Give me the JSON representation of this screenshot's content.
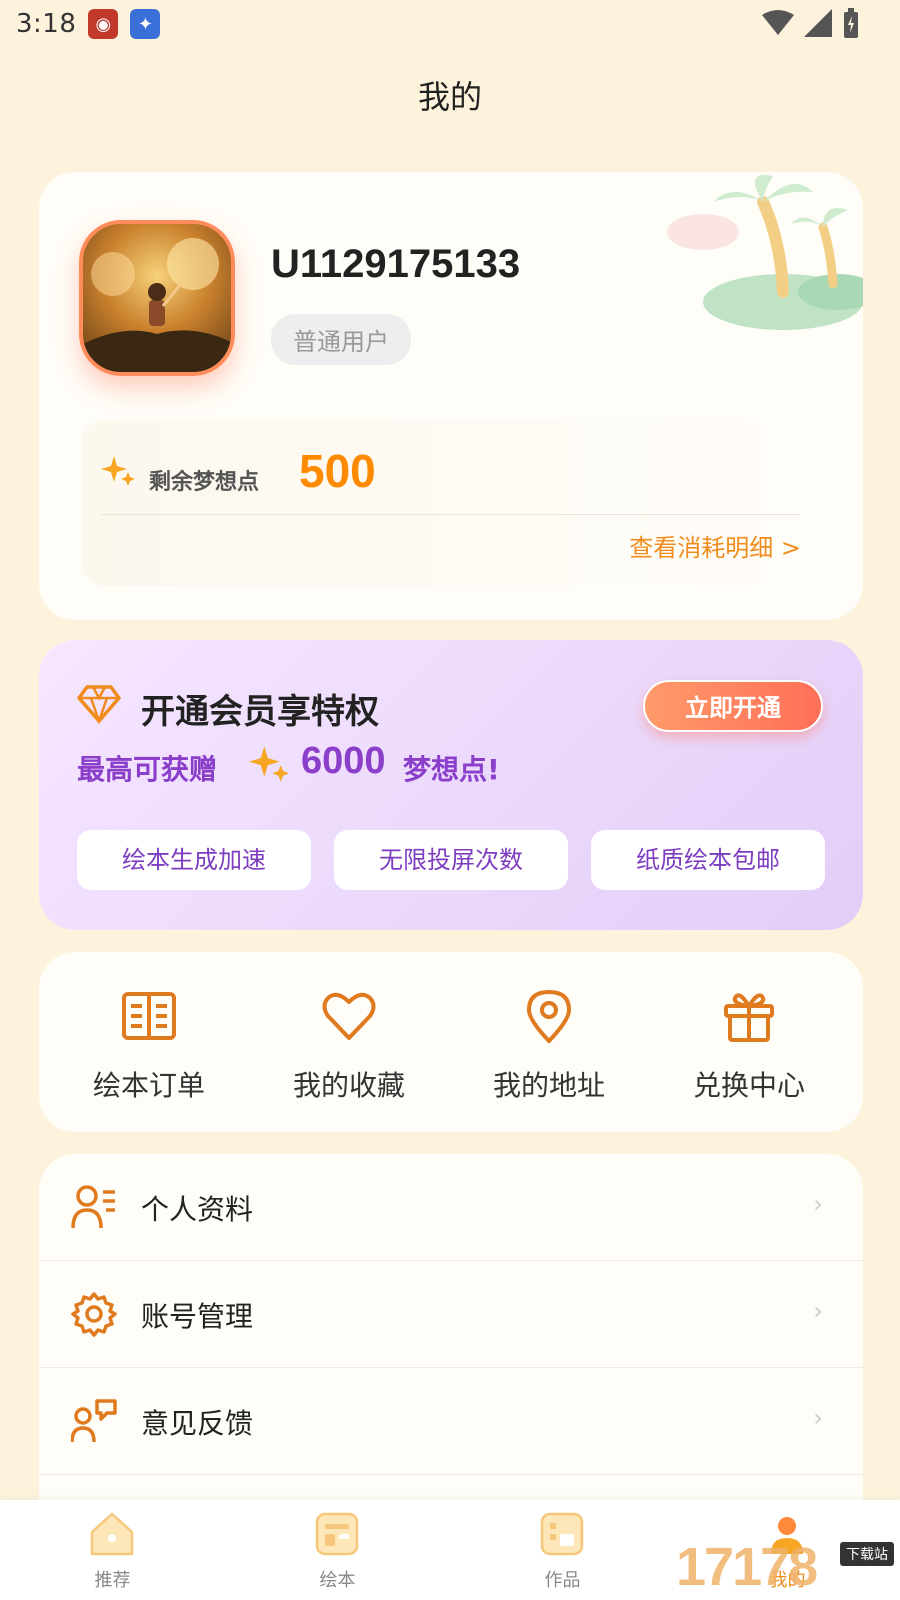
{
  "status_bar": {
    "time": "3:18"
  },
  "header": {
    "title": "我的"
  },
  "profile": {
    "username": "U1129175133",
    "user_type": "普通用户",
    "points_label": "剩余梦想点",
    "points_value": "500",
    "points_detail_link": "查看消耗明细 >"
  },
  "vip": {
    "title": "开通会员享特权",
    "button": "立即开通",
    "subtitle_prefix": "最高可获赠",
    "subtitle_number": "6000",
    "subtitle_suffix": "梦想点!",
    "perks": [
      "绘本生成加速",
      "无限投屏次数",
      "纸质绘本包邮"
    ]
  },
  "quick_actions": [
    {
      "label": "绘本订单",
      "icon": "book-icon"
    },
    {
      "label": "我的收藏",
      "icon": "heart-icon"
    },
    {
      "label": "我的地址",
      "icon": "location-icon"
    },
    {
      "label": "兑换中心",
      "icon": "gift-icon"
    }
  ],
  "menu": [
    {
      "label": "个人资料",
      "icon": "profile-icon"
    },
    {
      "label": "账号管理",
      "icon": "gear-icon"
    },
    {
      "label": "意见反馈",
      "icon": "feedback-icon"
    }
  ],
  "tabs": [
    {
      "label": "推荐"
    },
    {
      "label": "绘本"
    },
    {
      "label": "作品"
    },
    {
      "label": "我的"
    }
  ],
  "watermark": {
    "text": "17178",
    "tag": "下载站"
  },
  "colors": {
    "accent": "#f08c1c",
    "vip_purple": "#8a3ec9",
    "background": "#fdf3dc"
  }
}
